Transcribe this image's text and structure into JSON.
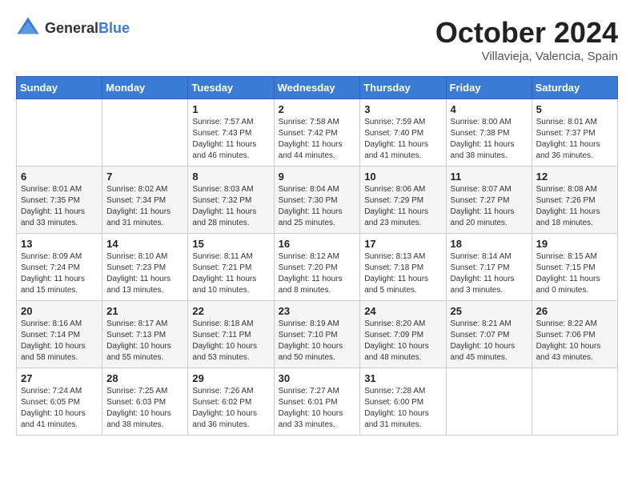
{
  "logo": {
    "text_general": "General",
    "text_blue": "Blue"
  },
  "header": {
    "month": "October 2024",
    "location": "Villavieja, Valencia, Spain"
  },
  "weekdays": [
    "Sunday",
    "Monday",
    "Tuesday",
    "Wednesday",
    "Thursday",
    "Friday",
    "Saturday"
  ],
  "weeks": [
    [
      {
        "day": "",
        "info": ""
      },
      {
        "day": "",
        "info": ""
      },
      {
        "day": "1",
        "info": "Sunrise: 7:57 AM\nSunset: 7:43 PM\nDaylight: 11 hours and 46 minutes."
      },
      {
        "day": "2",
        "info": "Sunrise: 7:58 AM\nSunset: 7:42 PM\nDaylight: 11 hours and 44 minutes."
      },
      {
        "day": "3",
        "info": "Sunrise: 7:59 AM\nSunset: 7:40 PM\nDaylight: 11 hours and 41 minutes."
      },
      {
        "day": "4",
        "info": "Sunrise: 8:00 AM\nSunset: 7:38 PM\nDaylight: 11 hours and 38 minutes."
      },
      {
        "day": "5",
        "info": "Sunrise: 8:01 AM\nSunset: 7:37 PM\nDaylight: 11 hours and 36 minutes."
      }
    ],
    [
      {
        "day": "6",
        "info": "Sunrise: 8:01 AM\nSunset: 7:35 PM\nDaylight: 11 hours and 33 minutes."
      },
      {
        "day": "7",
        "info": "Sunrise: 8:02 AM\nSunset: 7:34 PM\nDaylight: 11 hours and 31 minutes."
      },
      {
        "day": "8",
        "info": "Sunrise: 8:03 AM\nSunset: 7:32 PM\nDaylight: 11 hours and 28 minutes."
      },
      {
        "day": "9",
        "info": "Sunrise: 8:04 AM\nSunset: 7:30 PM\nDaylight: 11 hours and 25 minutes."
      },
      {
        "day": "10",
        "info": "Sunrise: 8:06 AM\nSunset: 7:29 PM\nDaylight: 11 hours and 23 minutes."
      },
      {
        "day": "11",
        "info": "Sunrise: 8:07 AM\nSunset: 7:27 PM\nDaylight: 11 hours and 20 minutes."
      },
      {
        "day": "12",
        "info": "Sunrise: 8:08 AM\nSunset: 7:26 PM\nDaylight: 11 hours and 18 minutes."
      }
    ],
    [
      {
        "day": "13",
        "info": "Sunrise: 8:09 AM\nSunset: 7:24 PM\nDaylight: 11 hours and 15 minutes."
      },
      {
        "day": "14",
        "info": "Sunrise: 8:10 AM\nSunset: 7:23 PM\nDaylight: 11 hours and 13 minutes."
      },
      {
        "day": "15",
        "info": "Sunrise: 8:11 AM\nSunset: 7:21 PM\nDaylight: 11 hours and 10 minutes."
      },
      {
        "day": "16",
        "info": "Sunrise: 8:12 AM\nSunset: 7:20 PM\nDaylight: 11 hours and 8 minutes."
      },
      {
        "day": "17",
        "info": "Sunrise: 8:13 AM\nSunset: 7:18 PM\nDaylight: 11 hours and 5 minutes."
      },
      {
        "day": "18",
        "info": "Sunrise: 8:14 AM\nSunset: 7:17 PM\nDaylight: 11 hours and 3 minutes."
      },
      {
        "day": "19",
        "info": "Sunrise: 8:15 AM\nSunset: 7:15 PM\nDaylight: 11 hours and 0 minutes."
      }
    ],
    [
      {
        "day": "20",
        "info": "Sunrise: 8:16 AM\nSunset: 7:14 PM\nDaylight: 10 hours and 58 minutes."
      },
      {
        "day": "21",
        "info": "Sunrise: 8:17 AM\nSunset: 7:13 PM\nDaylight: 10 hours and 55 minutes."
      },
      {
        "day": "22",
        "info": "Sunrise: 8:18 AM\nSunset: 7:11 PM\nDaylight: 10 hours and 53 minutes."
      },
      {
        "day": "23",
        "info": "Sunrise: 8:19 AM\nSunset: 7:10 PM\nDaylight: 10 hours and 50 minutes."
      },
      {
        "day": "24",
        "info": "Sunrise: 8:20 AM\nSunset: 7:09 PM\nDaylight: 10 hours and 48 minutes."
      },
      {
        "day": "25",
        "info": "Sunrise: 8:21 AM\nSunset: 7:07 PM\nDaylight: 10 hours and 45 minutes."
      },
      {
        "day": "26",
        "info": "Sunrise: 8:22 AM\nSunset: 7:06 PM\nDaylight: 10 hours and 43 minutes."
      }
    ],
    [
      {
        "day": "27",
        "info": "Sunrise: 7:24 AM\nSunset: 6:05 PM\nDaylight: 10 hours and 41 minutes."
      },
      {
        "day": "28",
        "info": "Sunrise: 7:25 AM\nSunset: 6:03 PM\nDaylight: 10 hours and 38 minutes."
      },
      {
        "day": "29",
        "info": "Sunrise: 7:26 AM\nSunset: 6:02 PM\nDaylight: 10 hours and 36 minutes."
      },
      {
        "day": "30",
        "info": "Sunrise: 7:27 AM\nSunset: 6:01 PM\nDaylight: 10 hours and 33 minutes."
      },
      {
        "day": "31",
        "info": "Sunrise: 7:28 AM\nSunset: 6:00 PM\nDaylight: 10 hours and 31 minutes."
      },
      {
        "day": "",
        "info": ""
      },
      {
        "day": "",
        "info": ""
      }
    ]
  ]
}
